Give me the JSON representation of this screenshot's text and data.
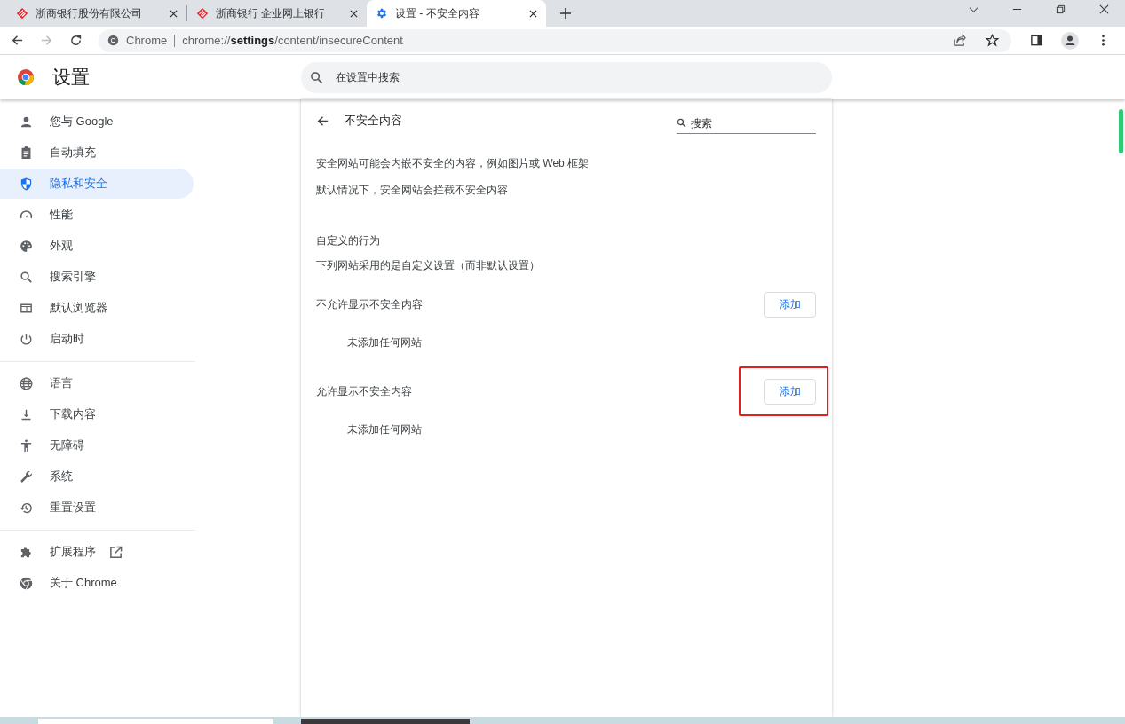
{
  "tabs": [
    {
      "title": "浙商银行股份有限公司",
      "kind": "bank",
      "selected": false
    },
    {
      "title": "浙商银行 企业网上银行",
      "kind": "bank",
      "selected": false
    },
    {
      "title": "设置 - 不安全内容",
      "kind": "settings",
      "selected": true
    }
  ],
  "toolbar": {
    "site_label": "Chrome",
    "url": "chrome://**settings**/content/insecureContent"
  },
  "header": {
    "title": "设置",
    "search_placeholder": "在设置中搜索"
  },
  "sidebar": {
    "groups": [
      [
        {
          "label": "您与 Google",
          "selected": false
        },
        {
          "label": "自动填充",
          "selected": false
        },
        {
          "label": "隐私和安全",
          "selected": true
        },
        {
          "label": "性能",
          "selected": false
        },
        {
          "label": "外观",
          "selected": false
        },
        {
          "label": "搜索引擎",
          "selected": false
        },
        {
          "label": "默认浏览器",
          "selected": false
        },
        {
          "label": "启动时",
          "selected": false
        }
      ],
      [
        {
          "label": "语言",
          "selected": false
        },
        {
          "label": "下载内容",
          "selected": false
        },
        {
          "label": "无障碍",
          "selected": false
        },
        {
          "label": "系统",
          "selected": false
        },
        {
          "label": "重置设置",
          "selected": false
        }
      ],
      [
        {
          "label": "扩展程序",
          "selected": false,
          "external": true
        },
        {
          "label": "关于 Chrome",
          "selected": false
        }
      ]
    ]
  },
  "page": {
    "title": "不安全内容",
    "search_placeholder": "搜索",
    "descriptions": [
      "安全网站可能会内嵌不安全的内容，例如图片或 Web 框架",
      "默认情况下，安全网站会拦截不安全内容"
    ],
    "custom_heading": "自定义的行为",
    "custom_subtitle": "下列网站采用的是自定义设置（而非默认设置）",
    "sections": [
      {
        "title": "不允许显示不安全内容",
        "button": "添加",
        "empty_text": "未添加任何网站",
        "highlighted": false
      },
      {
        "title": "允许显示不安全内容",
        "button": "添加",
        "empty_text": "未添加任何网站",
        "highlighted": true
      }
    ]
  }
}
